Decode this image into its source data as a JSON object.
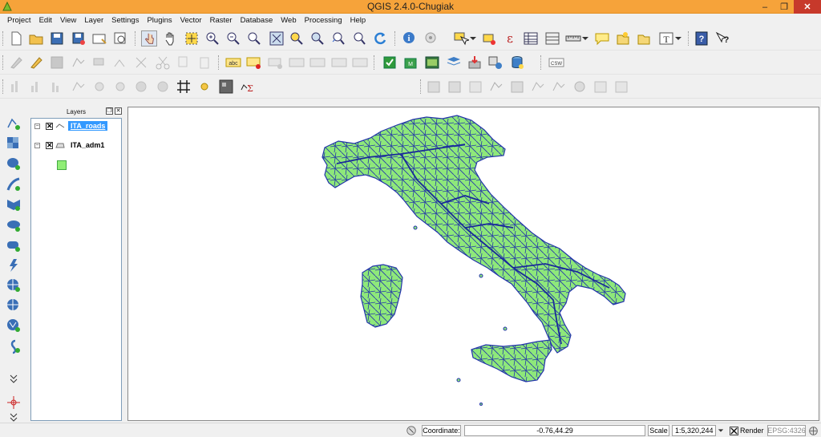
{
  "window": {
    "title": "QGIS 2.4.0-Chugiak",
    "minimize": "–",
    "restore": "❐",
    "close": "✕"
  },
  "menu": {
    "items": [
      "Project",
      "Edit",
      "View",
      "Layer",
      "Settings",
      "Plugins",
      "Vector",
      "Raster",
      "Database",
      "Web",
      "Processing",
      "Help"
    ]
  },
  "toolbar": {
    "csw_label": "CSW",
    "text_tool_label": "T",
    "help_label": "?"
  },
  "layers_panel": {
    "title": "Layers",
    "layers": [
      {
        "name": "ITA_roads",
        "visible": true,
        "selected": true
      },
      {
        "name": "ITA_adm1",
        "visible": true,
        "selected": false,
        "fill_color": "#90ee76"
      }
    ]
  },
  "map": {
    "land_color": "#8ee87a",
    "road_color": "#2233aa"
  },
  "status": {
    "coordinate_label": "Coordinate:",
    "coordinate_value": "-0.76,44.29",
    "scale_label": "Scale",
    "scale_value": "1:5,320,244",
    "render_label": "Render",
    "crs_label": "EPSG:4326"
  },
  "icons": {
    "left_toolbar": [
      "add-vector-layer-icon",
      "add-raster-layer-icon",
      "add-postgis-layer-icon",
      "add-spatialite-layer-icon",
      "add-mssql-layer-icon",
      "add-oracle-layer-icon",
      "add-sqlanywhere-layer-icon",
      "add-wms-layer-icon",
      "add-wcs-layer-icon",
      "add-wfs-layer-icon",
      "add-delimited-text-icon",
      "more-icon",
      "gps-icon",
      "more-icon-2"
    ]
  }
}
